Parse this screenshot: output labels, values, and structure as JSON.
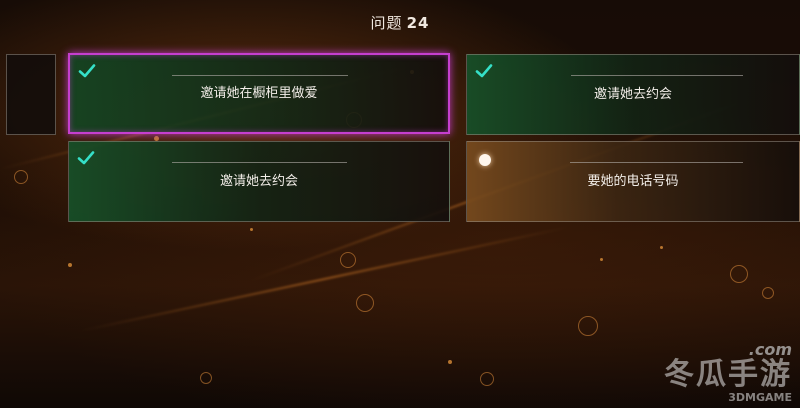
{
  "header": {
    "question_label": "问题",
    "question_number": "24"
  },
  "options": [
    {
      "label": "邀请她在橱柜里做爱",
      "marker": "check-icon",
      "state": "selected",
      "color": "#1e6a38"
    },
    {
      "label": "邀请她去约会",
      "marker": "check-icon",
      "state": "chosen-before",
      "color": "#1e6a38"
    },
    {
      "label": "邀请她去约会",
      "marker": "check-icon",
      "state": "chosen-before",
      "color": "#1e6a38"
    },
    {
      "label": "要她的电话号码",
      "marker": "dot-icon",
      "state": "unchosen",
      "color": "#7a4b1e"
    }
  ],
  "colors": {
    "check": "#35e0c8",
    "selected_border": "#c53fcf"
  },
  "watermark": {
    "domain": ".com",
    "brand": "冬瓜手游",
    "site": "3DMGAME"
  }
}
